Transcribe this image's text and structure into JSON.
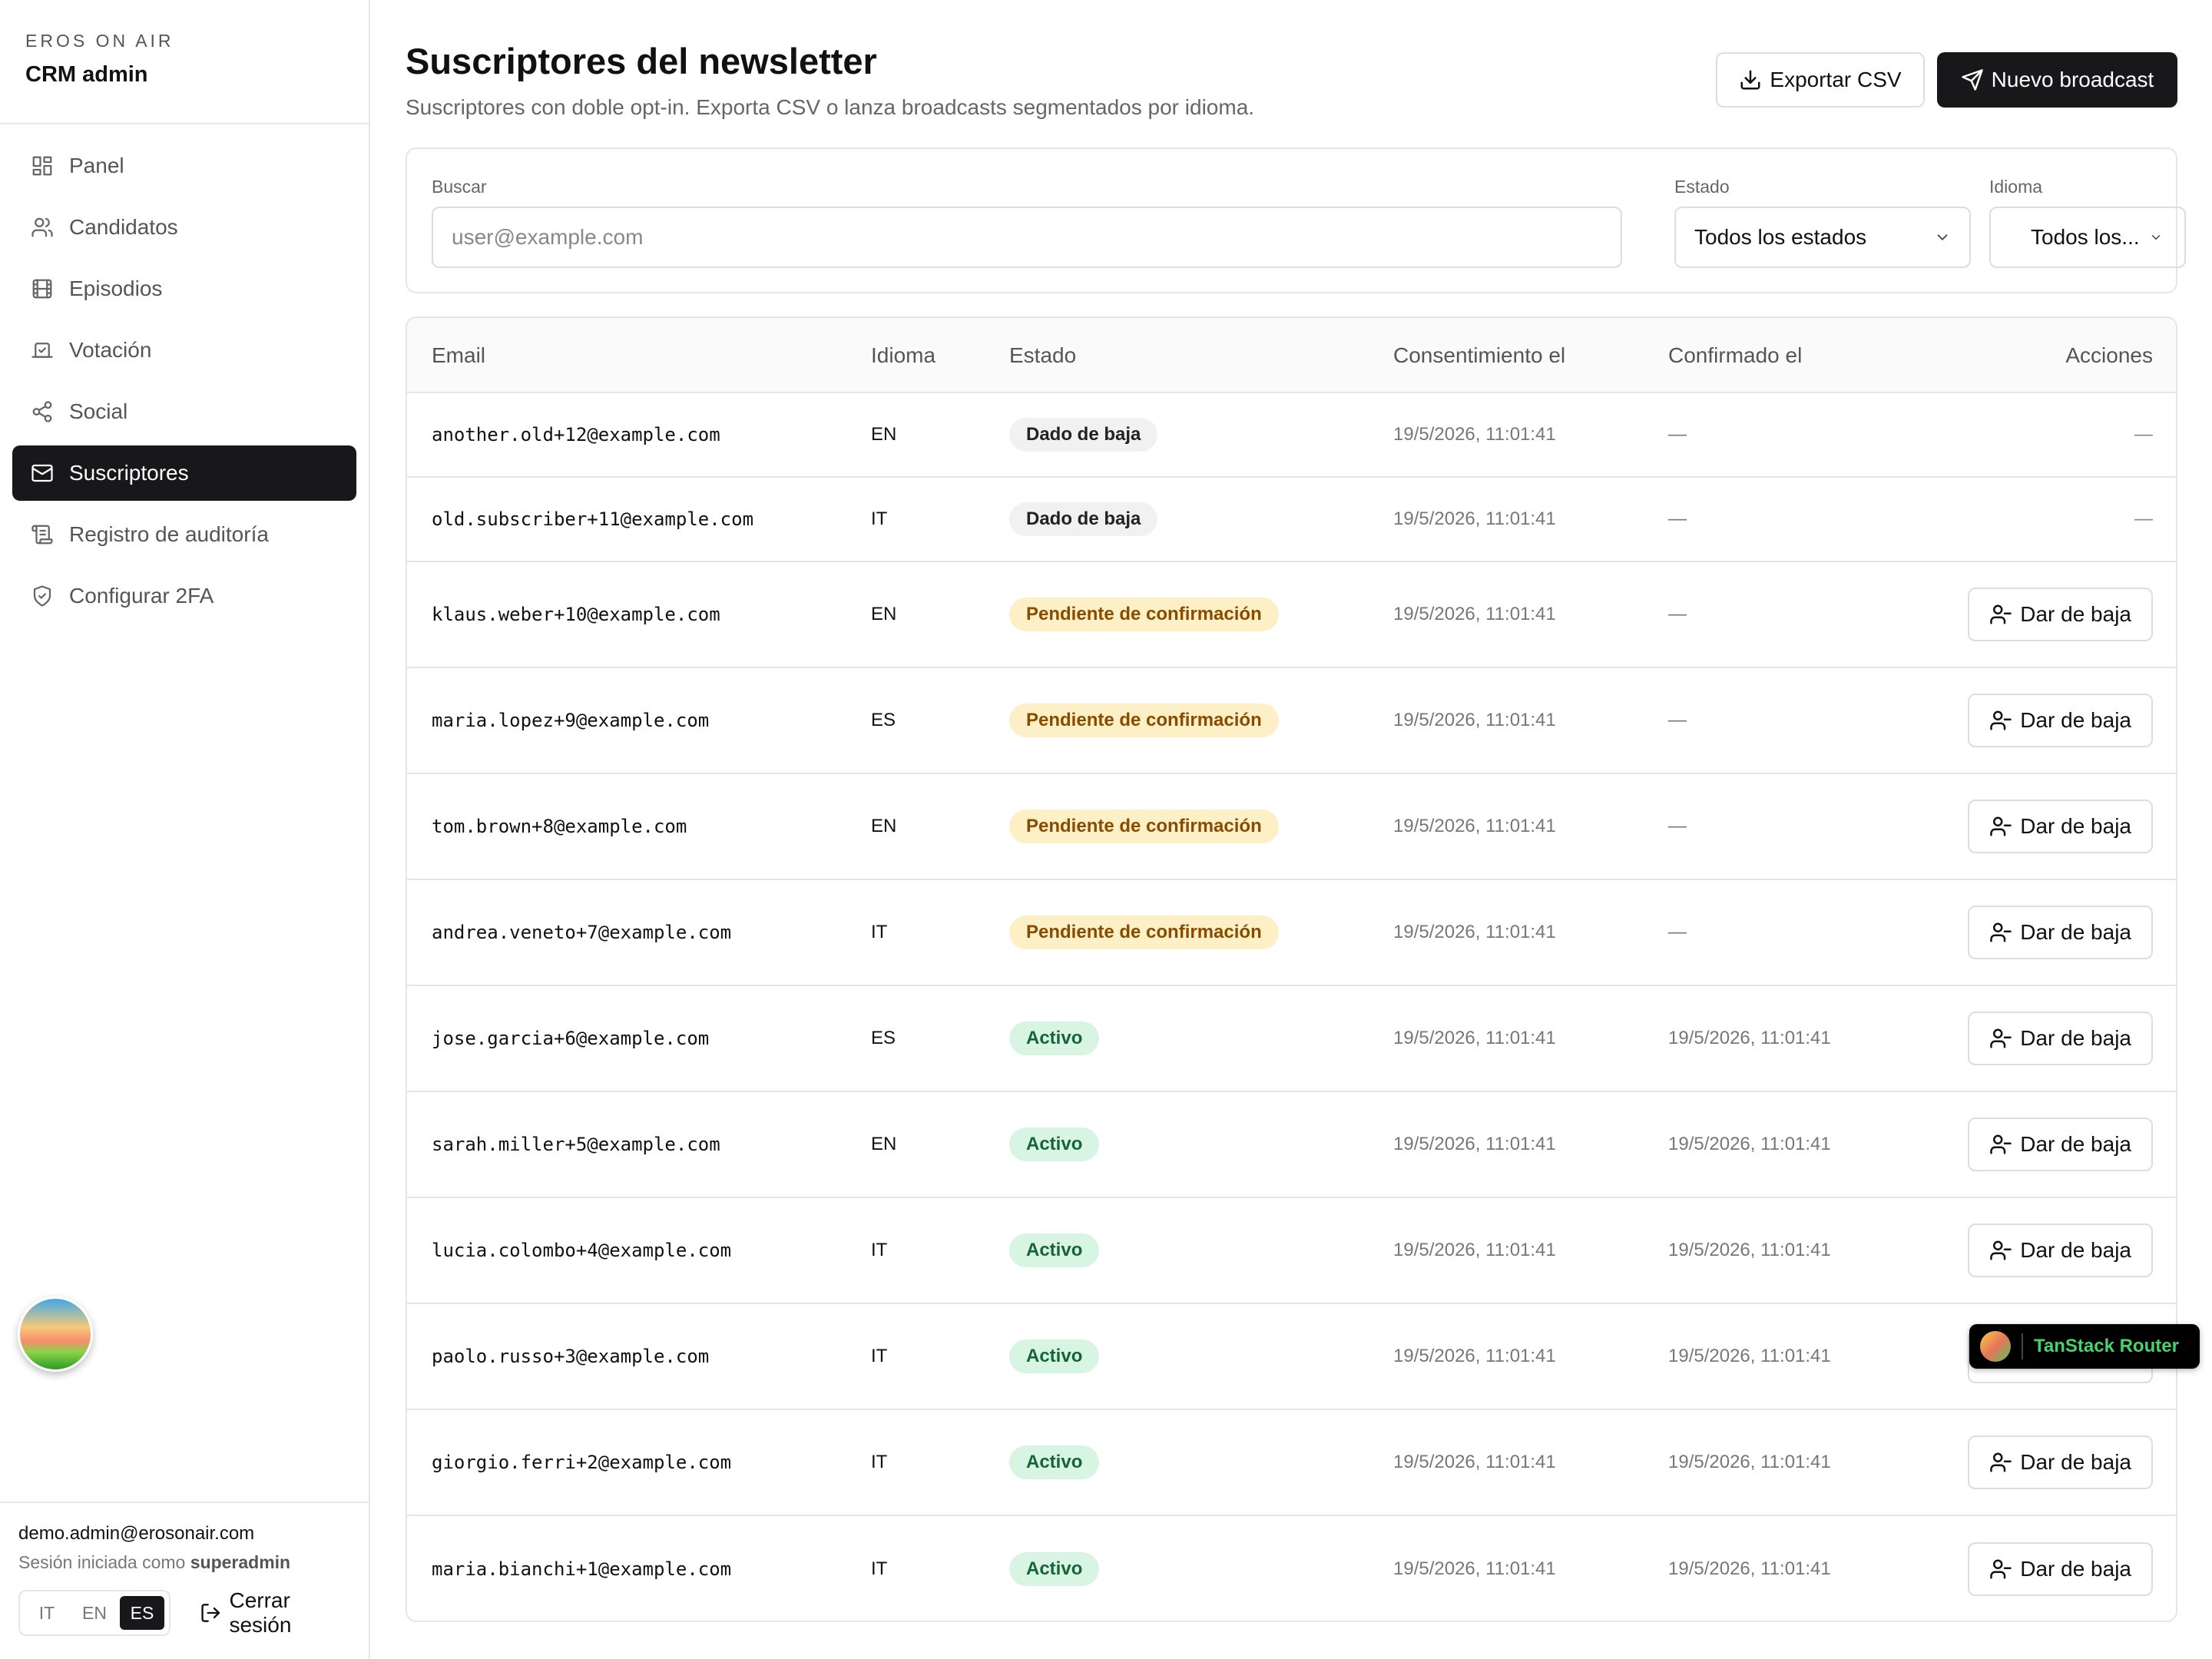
{
  "brand": {
    "subtitle": "EROS ON AIR",
    "title": "CRM admin"
  },
  "nav": [
    {
      "label": "Panel",
      "icon": "dashboard-icon"
    },
    {
      "label": "Candidatos",
      "icon": "users-icon"
    },
    {
      "label": "Episodios",
      "icon": "film-icon"
    },
    {
      "label": "Votación",
      "icon": "vote-icon"
    },
    {
      "label": "Social",
      "icon": "share-icon"
    },
    {
      "label": "Suscriptores",
      "icon": "mail-icon",
      "active": true
    },
    {
      "label": "Registro de auditoría",
      "icon": "scroll-icon"
    },
    {
      "label": "Configurar 2FA",
      "icon": "shield-icon"
    }
  ],
  "footer": {
    "email": "demo.admin@erosonair.com",
    "role_prefix": "Sesión iniciada como",
    "role": "superadmin",
    "languages": [
      "IT",
      "EN",
      "ES"
    ],
    "active_language": "ES",
    "logout": "Cerrar sesión"
  },
  "header": {
    "title": "Suscriptores del newsletter",
    "description": "Suscriptores con doble opt-in. Exporta CSV o lanza broadcasts segmentados por idioma.",
    "export_label": "Exportar CSV",
    "new_label": "Nuevo broadcast"
  },
  "filters": {
    "search_label": "Buscar",
    "search_placeholder": "user@example.com",
    "status_label": "Estado",
    "status_value": "Todos los estados",
    "lang_label": "Idioma",
    "lang_value": "Todos los..."
  },
  "table": {
    "columns": [
      "Email",
      "Idioma",
      "Estado",
      "Consentimiento el",
      "Confirmado el",
      "Acciones"
    ],
    "action_label": "Dar de baja",
    "rows": [
      {
        "email": "another.old+12@example.com",
        "lang": "EN",
        "status": "Dado de baja",
        "kind": "gray",
        "consent": "19/5/2026, 11:01:41",
        "confirmed": "—",
        "action": false
      },
      {
        "email": "old.subscriber+11@example.com",
        "lang": "IT",
        "status": "Dado de baja",
        "kind": "gray",
        "consent": "19/5/2026, 11:01:41",
        "confirmed": "—",
        "action": false
      },
      {
        "email": "klaus.weber+10@example.com",
        "lang": "EN",
        "status": "Pendiente de confirmación",
        "kind": "yellow",
        "consent": "19/5/2026, 11:01:41",
        "confirmed": "—",
        "action": true
      },
      {
        "email": "maria.lopez+9@example.com",
        "lang": "ES",
        "status": "Pendiente de confirmación",
        "kind": "yellow",
        "consent": "19/5/2026, 11:01:41",
        "confirmed": "—",
        "action": true
      },
      {
        "email": "tom.brown+8@example.com",
        "lang": "EN",
        "status": "Pendiente de confirmación",
        "kind": "yellow",
        "consent": "19/5/2026, 11:01:41",
        "confirmed": "—",
        "action": true
      },
      {
        "email": "andrea.veneto+7@example.com",
        "lang": "IT",
        "status": "Pendiente de confirmación",
        "kind": "yellow",
        "consent": "19/5/2026, 11:01:41",
        "confirmed": "—",
        "action": true
      },
      {
        "email": "jose.garcia+6@example.com",
        "lang": "ES",
        "status": "Activo",
        "kind": "green",
        "consent": "19/5/2026, 11:01:41",
        "confirmed": "19/5/2026, 11:01:41",
        "action": true
      },
      {
        "email": "sarah.miller+5@example.com",
        "lang": "EN",
        "status": "Activo",
        "kind": "green",
        "consent": "19/5/2026, 11:01:41",
        "confirmed": "19/5/2026, 11:01:41",
        "action": true
      },
      {
        "email": "lucia.colombo+4@example.com",
        "lang": "IT",
        "status": "Activo",
        "kind": "green",
        "consent": "19/5/2026, 11:01:41",
        "confirmed": "19/5/2026, 11:01:41",
        "action": true
      },
      {
        "email": "paolo.russo+3@example.com",
        "lang": "IT",
        "status": "Activo",
        "kind": "green",
        "consent": "19/5/2026, 11:01:41",
        "confirmed": "19/5/2026, 11:01:41",
        "action": true
      },
      {
        "email": "giorgio.ferri+2@example.com",
        "lang": "IT",
        "status": "Activo",
        "kind": "green",
        "consent": "19/5/2026, 11:01:41",
        "confirmed": "19/5/2026, 11:01:41",
        "action": true
      },
      {
        "email": "maria.bianchi+1@example.com",
        "lang": "IT",
        "status": "Activo",
        "kind": "green",
        "consent": "19/5/2026, 11:01:41",
        "confirmed": "19/5/2026, 11:01:41",
        "action": true
      }
    ]
  },
  "devtools": {
    "label": "TanStack Router"
  },
  "colors": {
    "primary": "#18181b",
    "pending_bg": "#fdf0c7",
    "active_bg": "#d8f5e3",
    "accent_green": "#46d36b"
  }
}
